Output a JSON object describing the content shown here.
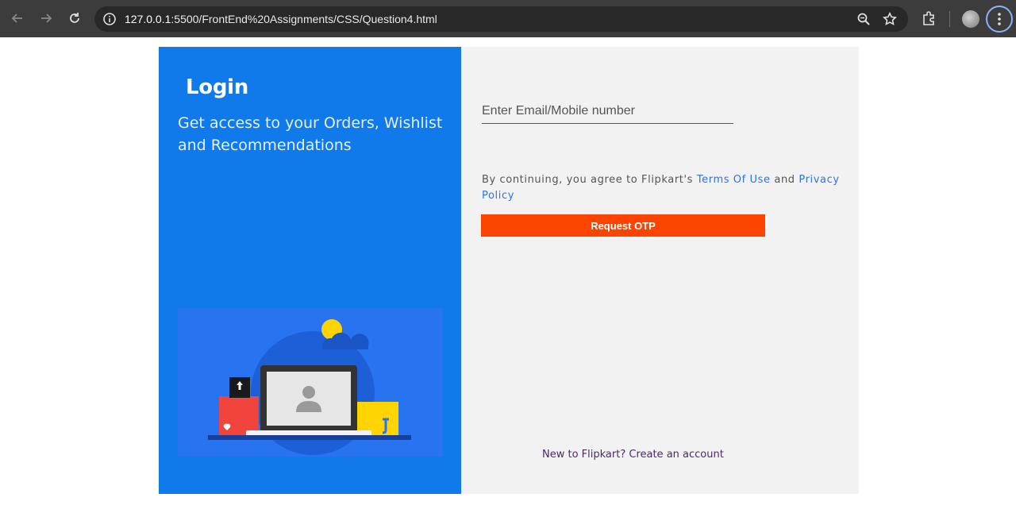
{
  "browser": {
    "url_host": "127.0.0.1",
    "url_rest": ":5500/FrontEnd%20Assignments/CSS/Question4.html"
  },
  "login": {
    "title": "Login",
    "subtitle": "Get access to your Orders, Wishlist and Recommendations"
  },
  "form": {
    "email_placeholder": "Enter Email/Mobile number",
    "terms_prefix": "By continuing, you agree to Flipkart's ",
    "terms_link": "Terms Of Use",
    "terms_and": " and ",
    "privacy_link": "Privacy Policy",
    "otp_button": "Request OTP",
    "new_account": "New to Flipkart? Create an account"
  },
  "colors": {
    "left_panel": "#107aeb",
    "right_panel": "#f2f2f2",
    "otp_button": "#fb4400",
    "link": "#2874f0"
  },
  "icons": [
    "back-arrow-icon",
    "forward-arrow-icon",
    "reload-icon",
    "info-icon",
    "zoom-icon",
    "star-icon",
    "extensions-icon",
    "kebab-menu-icon"
  ]
}
